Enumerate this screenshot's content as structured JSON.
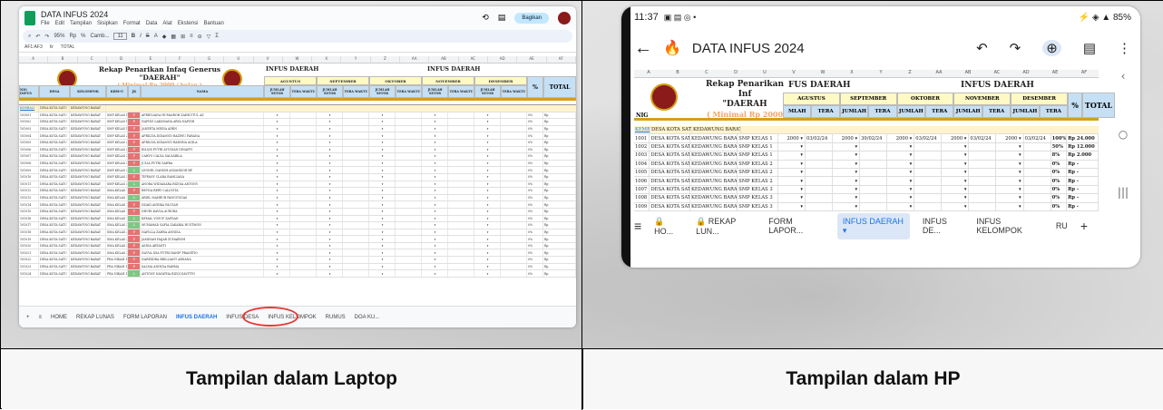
{
  "captions": {
    "left": "Tampilan dalam Laptop",
    "right": "Tampilan dalam HP"
  },
  "laptop": {
    "doc_title": "DATA INFUS 2024",
    "menu": [
      "File",
      "Edit",
      "Tampilan",
      "Sisipkan",
      "Format",
      "Data",
      "Alat",
      "Ekstensi",
      "Bantuan"
    ],
    "share_label": "Bagikan",
    "toolbar": {
      "zoom": "95%",
      "font": "Camb...",
      "size": "11"
    },
    "cell_ref": "AF1:AF3",
    "formula": "TOTAL",
    "sheet_title": "Rekap Penarikan Infaq Generus",
    "sheet_daerah": "\"DAERAH\"",
    "sheet_min": "( Minimal Rp 2000 / bulan )",
    "infus_daerah_1": "INFUS DAERAH",
    "infus_daerah_2": "INFUS DAERAH",
    "months": [
      "AGUSTUS",
      "SEPTEMBER",
      "OKTOBER",
      "NOVEMBER",
      "DESEMBER"
    ],
    "sub_jumlah": "JUMLAH SETOR",
    "sub_tera": "TERA WAKTU",
    "left_headers": [
      "NIG INFUS",
      "DESA",
      "KELOMPOK",
      "KBM-U",
      "JK",
      "NAMA"
    ],
    "pct": "%",
    "total": "TOTAL",
    "first_row": {
      "kembali": "KEMBALI",
      "desa": "DESA KOTA SATU",
      "kel": "KEDAWUNG BARAT"
    },
    "rows": [
      {
        "nig": "101001",
        "desa": "DESA KOTA SATU",
        "kel": "KEDAWUNG BARAT",
        "kbm": "SMP KELAS 1",
        "jk": "P",
        "nama": "AFRIELIANA HUMAIROH ZAHNUTUL AZ"
      },
      {
        "nig": "101002",
        "desa": "DESA KOTA SATU",
        "kel": "KEDAWUNG BARAT",
        "kbm": "SMP KELAS 1",
        "jk": "P",
        "nama": "NAFIDZ LAKSMANA ARYA NAFISH"
      },
      {
        "nig": "101003",
        "desa": "DESA KOTA SATU",
        "kel": "KEDAWUNG BARAT",
        "kbm": "SMP KELAS 1",
        "jk": "P",
        "nama": "JANEETA MEDIA AIRIN"
      },
      {
        "nig": "101004",
        "desa": "DESA KOTA SATU",
        "kel": "KEDAWUNG BARAT",
        "kbm": "SMP KELAS 2",
        "jk": "P",
        "nama": "APRILIYA DIDAMUD RAZIWU FARANA"
      },
      {
        "nig": "101005",
        "desa": "DESA KOTA SATU",
        "kel": "KEDAWUNG BARAT",
        "kbm": "SMP KELAS 2",
        "jk": "P",
        "nama": "APRILIYA DIDAMUD RADHNA AQILA"
      },
      {
        "nig": "101006",
        "desa": "DESA KOTA SATU",
        "kel": "KEDAWUNG BARAT",
        "kbm": "SMP KELAS 2",
        "jk": "P",
        "nama": "RILQIS PUTRI AYUDIAN DINAFFI"
      },
      {
        "nig": "101007",
        "desa": "DESA KOTA SATU",
        "kel": "KEDAWUNG BARAT",
        "kbm": "SMP KELAS 2",
        "jk": "P",
        "nama": "CAHYO CALSA SALSABILA"
      },
      {
        "nig": "101008",
        "desa": "DESA KOTA SATU",
        "kel": "KEDAWUNG BARAT",
        "kbm": "SMP KELAS 3",
        "jk": "P",
        "nama": "JULIA PUTRI ZAHRA"
      },
      {
        "nig": "101009",
        "desa": "DESA KOTA SATU",
        "kel": "KEDAWUNG BARAT",
        "kbm": "SMP KELAS 3",
        "jk": "L",
        "nama": "LEONEL DANISH ASSANISOR RP"
      },
      {
        "nig": "101010",
        "desa": "DESA KOTA SATU",
        "kel": "KEDAWUNG BARAT",
        "kbm": "SMP KELAS 3",
        "jk": "P",
        "nama": "TIFFANY CLARA RAMLIANA"
      },
      {
        "nig": "101011",
        "desa": "DESA KOTA SATU",
        "kel": "KEDAWUNG BARAT",
        "kbm": "SMP KELAS 3",
        "jk": "L",
        "nama": "ANORA WIDIASARA RIZQIA ANTONY"
      },
      {
        "nig": "101012",
        "desa": "DESA KOTA SATU",
        "kel": "KEDAWUNG BARAT",
        "kbm": "SMA KELAS 1",
        "jk": "P",
        "nama": "REVNA RERY CALLYSTA"
      },
      {
        "nig": "101013",
        "desa": "DESA KOTA SATU",
        "kel": "KEDAWUNG BARAT",
        "kbm": "SMA KELAS 1",
        "jk": "L",
        "nama": "ARIEL MAHRUB PANGUNGAS"
      },
      {
        "nig": "101014",
        "desa": "DESA KOTA SATU",
        "kel": "KEDAWUNG BARAT",
        "kbm": "SMA KELAS 1",
        "jk": "P",
        "nama": "DZAKI ANDIKA FAUZAN"
      },
      {
        "nig": "101015",
        "desa": "DESA KOTA SATU",
        "kel": "KEDAWUNG BARAT",
        "kbm": "SMA KELAS 1",
        "jk": "P",
        "nama": "DHURI KAVSA AURORA"
      },
      {
        "nig": "101016",
        "desa": "DESA KOTA SATU",
        "kel": "KEDAWUNG BARAT",
        "kbm": "SMA KELAS 1",
        "jk": "L",
        "nama": "KEMAL YOSUF ZAFDAN"
      },
      {
        "nig": "101017",
        "desa": "DESA KOTA SATU",
        "kel": "KEDAWUNG BARAT",
        "kbm": "SMA KELAS 2",
        "jk": "L",
        "nama": "MUHAMAD SAFIA ZAKARIA HUSTMON"
      },
      {
        "nig": "101018",
        "desa": "DESA KOTA SATU",
        "kel": "KEDAWUNG BARAT",
        "kbm": "SMA KELAS 2",
        "jk": "P",
        "nama": "NAFILLA ZAHRA ANNISA"
      },
      {
        "nig": "101019",
        "desa": "DESA KOTA SATU",
        "kel": "KEDAWUNG BARAT",
        "kbm": "SMA KELAS 2",
        "jk": "P",
        "nama": "JAMINAH HAJAR ZUHAIROH"
      },
      {
        "nig": "101020",
        "desa": "DESA KOTA SATU",
        "kel": "KEDAWUNG BARAT",
        "kbm": "SMA KELAS 3",
        "jk": "P",
        "nama": "ASNIA ARTANTI"
      },
      {
        "nig": "101021",
        "desa": "DESA KOTA SATU",
        "kel": "KEDAWUNG BARAT",
        "kbm": "SMA KELAS 3",
        "jk": "P",
        "nama": "NAYVA IZIA PUTRI HANIF PRASETIO"
      },
      {
        "nig": "101022",
        "desa": "DESA KOTA SATU",
        "kel": "KEDAWUNG BARAT",
        "kbm": "PRA NIKAH 1",
        "jk": "P",
        "nama": "NAREXDRA BRILLIANT ARDANA"
      },
      {
        "nig": "101023",
        "desa": "DESA KOTA SATU",
        "kel": "KEDAWUNG BARAT",
        "kbm": "PRA NIKAH 1",
        "jk": "P",
        "nama": "SALMA ANINDA RAHMA"
      },
      {
        "nig": "101024",
        "desa": "DESA KOTA SATU",
        "kel": "KEDAWUNG BARAT",
        "kbm": "PRA NIKAH 1",
        "jk": "L",
        "nama": "ANTONY NAVATHA RIZQI DAVITTO"
      }
    ],
    "pct_value": "0%",
    "rp": "Rp",
    "tabs": [
      "+",
      "≡",
      "HOME",
      "REKAP LUNAS",
      "FORM LAPORAN",
      "INFUS DAERAH",
      "INFUS DESA",
      "INFUS KELOMPOK",
      "RUMUS",
      "DOA KU..."
    ]
  },
  "phone": {
    "time": "11:37",
    "battery": "85%",
    "doc_title": "DATA INFUS 2024",
    "sheet_title": "Rekap Penarikan Inf",
    "sheet_daerah": "\"DAERAH",
    "sheet_min": "( Minimal Rp 2000",
    "infus_1": "FUS DAERAH",
    "infus_2": "INFUS DAERAH",
    "months": [
      "AGUSTUS",
      "SEPTEMBER",
      "OKTOBER",
      "NOVEMBER",
      "DESEMBER"
    ],
    "sub": [
      "MLAH",
      "TERA",
      "JUMLAH",
      "TERA",
      "JUMLAH",
      "TERA",
      "JUMLAH",
      "TERA",
      "JUMLAH",
      "TERA"
    ],
    "pct": "%",
    "total": "TOTAL",
    "nig_head": "NIG",
    "first_row": {
      "kembali": "KEMBALI",
      "desa": "DESA KOTA SATU",
      "kel": "KEDAWUNG BARAT"
    },
    "rows": [
      {
        "nig": "1001",
        "desa": "DESA KOTA SATU",
        "kel": "KEDAWUNG BARAT",
        "kbm": "SMP KELAS 1",
        "a": "2000",
        "d1": "03/02/24",
        "b": "2000",
        "d2": "30/02/24",
        "c": "2000",
        "d3": "03/02/24",
        "e": "2000",
        "d4": "03/02/24",
        "f": "2000",
        "d5": "03/02/24",
        "pct": "100%",
        "rp": "Rp 24.000"
      },
      {
        "nig": "1002",
        "desa": "DESA KOTA SATU",
        "kel": "KEDAWUNG BARAT",
        "kbm": "SMP KELAS 1",
        "a": "",
        "d1": "",
        "b": "",
        "d2": "",
        "c": "",
        "d3": "",
        "e": "",
        "d4": "",
        "f": "",
        "d5": "",
        "pct": "50%",
        "rp": "Rp 12.000"
      },
      {
        "nig": "1003",
        "desa": "DESA KOTA SATU",
        "kel": "KEDAWUNG BARAT",
        "kbm": "SMP KELAS 1",
        "a": "",
        "d1": "",
        "b": "",
        "d2": "",
        "c": "",
        "d3": "",
        "e": "",
        "d4": "",
        "f": "",
        "d5": "",
        "pct": "8%",
        "rp": "Rp 2.000"
      },
      {
        "nig": "1004",
        "desa": "DESA KOTA SATU",
        "kel": "KEDAWUNG BARAT",
        "kbm": "SMP KELAS 2",
        "a": "",
        "d1": "",
        "b": "",
        "d2": "",
        "c": "",
        "d3": "",
        "e": "",
        "d4": "",
        "f": "",
        "d5": "",
        "pct": "0%",
        "rp": "Rp -"
      },
      {
        "nig": "1005",
        "desa": "DESA KOTA SATU",
        "kel": "KEDAWUNG BARAT",
        "kbm": "SMP KELAS 2",
        "a": "",
        "d1": "",
        "b": "",
        "d2": "",
        "c": "",
        "d3": "",
        "e": "",
        "d4": "",
        "f": "",
        "d5": "",
        "pct": "0%",
        "rp": "Rp -"
      },
      {
        "nig": "1006",
        "desa": "DESA KOTA SATU",
        "kel": "KEDAWUNG BARAT",
        "kbm": "SMP KELAS 2",
        "a": "",
        "d1": "",
        "b": "",
        "d2": "",
        "c": "",
        "d3": "",
        "e": "",
        "d4": "",
        "f": "",
        "d5": "",
        "pct": "0%",
        "rp": "Rp -"
      },
      {
        "nig": "1007",
        "desa": "DESA KOTA SATU",
        "kel": "KEDAWUNG BARAT",
        "kbm": "SMP KELAS 3",
        "a": "",
        "d1": "",
        "b": "",
        "d2": "",
        "c": "",
        "d3": "",
        "e": "",
        "d4": "",
        "f": "",
        "d5": "",
        "pct": "0%",
        "rp": "Rp -"
      },
      {
        "nig": "1008",
        "desa": "DESA KOTA SATU",
        "kel": "KEDAWUNG BARAT",
        "kbm": "SMP KELAS 3",
        "a": "",
        "d1": "",
        "b": "",
        "d2": "",
        "c": "",
        "d3": "",
        "e": "",
        "d4": "",
        "f": "",
        "d5": "",
        "pct": "0%",
        "rp": "Rp -"
      },
      {
        "nig": "1009",
        "desa": "DESA KOTA SATU",
        "kel": "KEDAWUNG BARAT",
        "kbm": "SMP KELAS 3",
        "a": "",
        "d1": "",
        "b": "",
        "d2": "",
        "c": "",
        "d3": "",
        "e": "",
        "d4": "",
        "f": "",
        "d5": "",
        "pct": "0%",
        "rp": "Rp -"
      }
    ],
    "tabs": [
      "HO...",
      "REKAP LUN...",
      "FORM LAPOR...",
      "INFUS DAERAH",
      "INFUS DE...",
      "INFUS KELOMPOK",
      "RU"
    ]
  }
}
